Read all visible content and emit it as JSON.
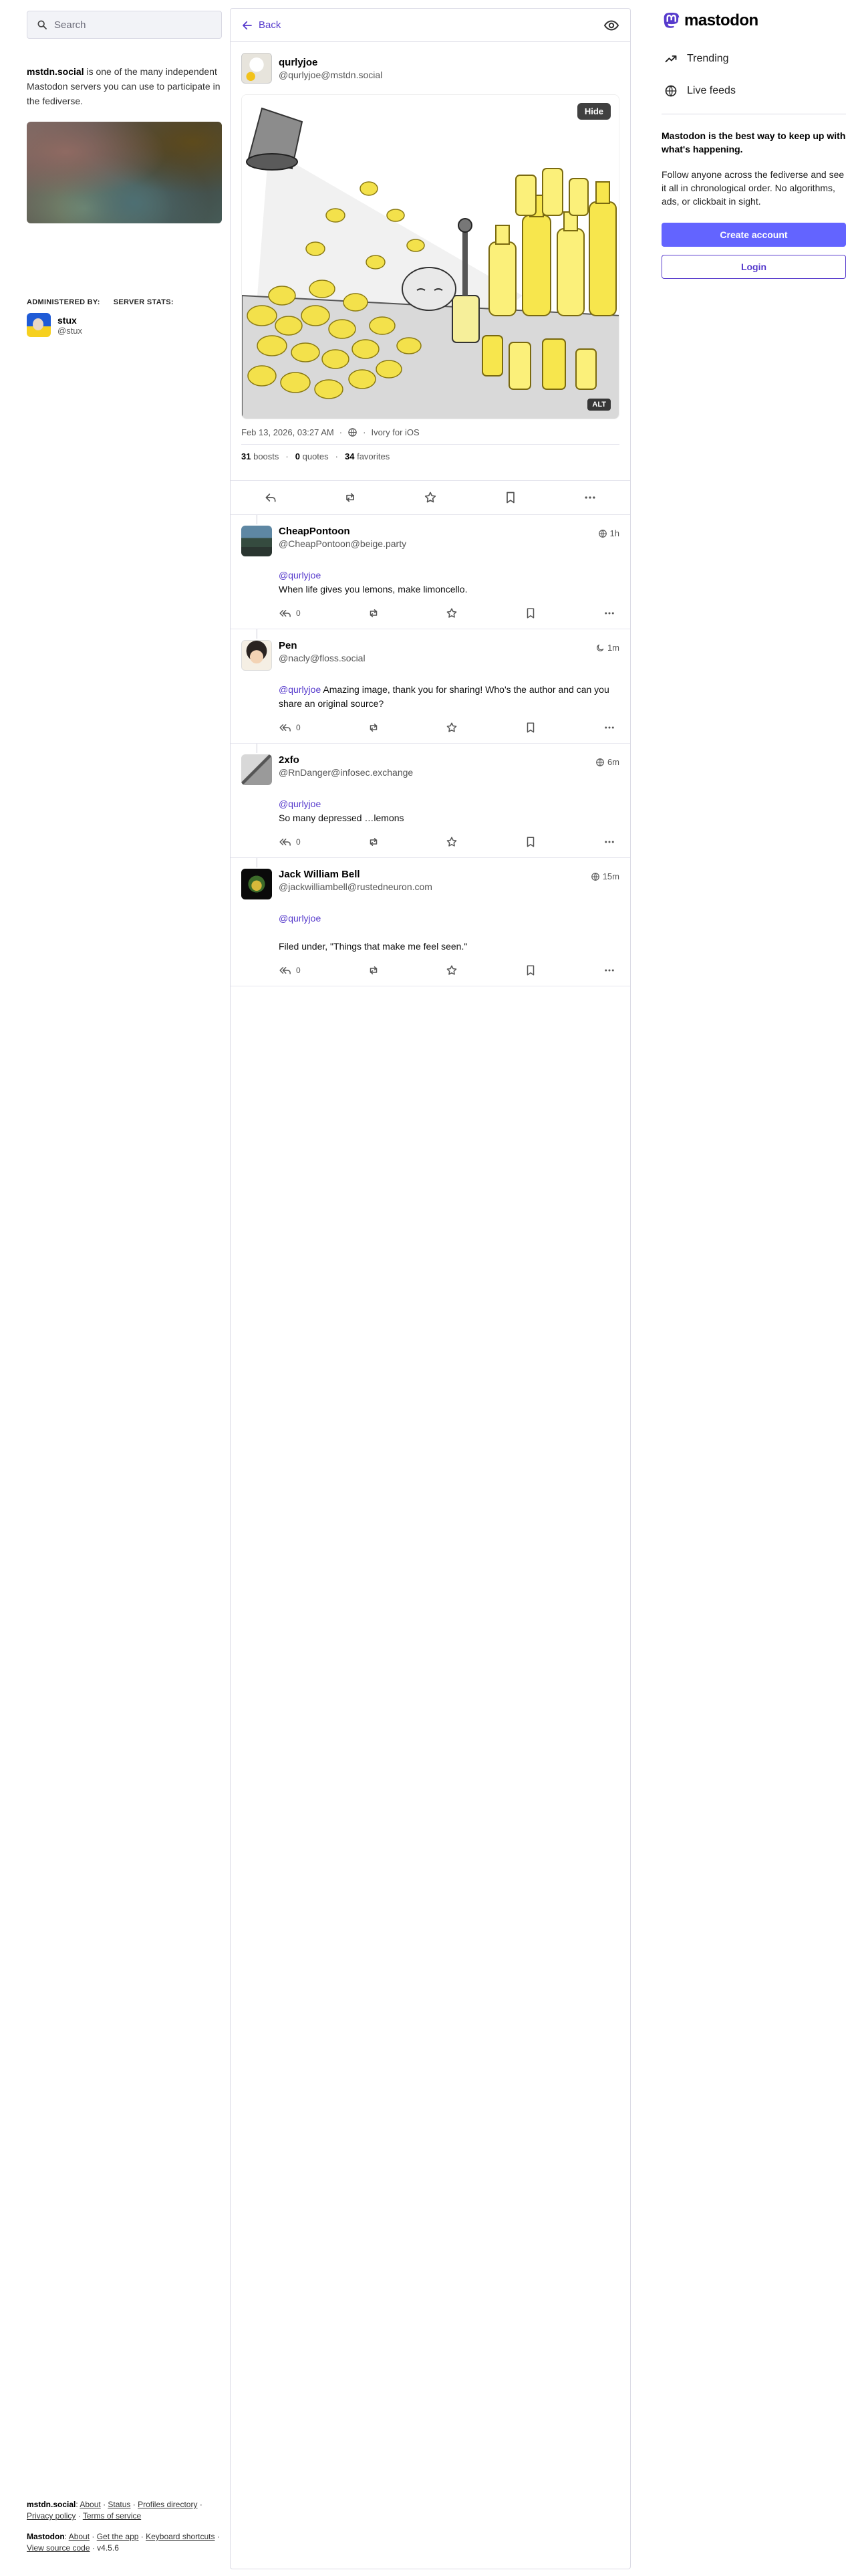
{
  "search": {
    "placeholder": "Search"
  },
  "server": {
    "name": "mstdn.social",
    "about_rest": " is one of the many independent Mastodon servers you can use to participate in the fediverse.",
    "administered_by_label": "ADMINISTERED BY:",
    "server_stats_label": "SERVER STATS:",
    "admin": {
      "name": "stux",
      "handle": "@stux"
    }
  },
  "footer": {
    "server_label": "mstdn.social",
    "server_links": [
      "About",
      "Status",
      "Profiles directory",
      "Privacy policy",
      "Terms of service"
    ],
    "mastodon_label": "Mastodon",
    "mastodon_links": [
      "About",
      "Get the app",
      "Keyboard shortcuts",
      "View source code"
    ],
    "version": "v4.5.6"
  },
  "topbar": {
    "back_label": "Back"
  },
  "post": {
    "display_name": "qurlyjoe",
    "acct": "@qurlyjoe@mstdn.social",
    "hide_label": "Hide",
    "alt_label": "ALT",
    "timestamp": "Feb 13, 2026, 03:27 AM",
    "client": "Ivory for iOS",
    "boosts": "31",
    "boosts_label": "boosts",
    "quotes": "0",
    "quotes_label": "quotes",
    "favorites": "34",
    "favorites_label": "favorites"
  },
  "replies": [
    {
      "display_name": "CheapPontoon",
      "acct": "@CheapPontoon@beige.party",
      "time": "1h",
      "visibility_icon": "globe-icon",
      "mention": "",
      "mention_line": "@qurlyjoe",
      "text": "When life gives you lemons, make limoncello.",
      "reply_count": "0"
    },
    {
      "display_name": "Pen",
      "acct": "@nacly@floss.social",
      "time": "1m",
      "visibility_icon": "moon-icon",
      "mention": "@qurlyjoe",
      "text": " Amazing image, thank you for sharing! Who's the author and can you share an original source?",
      "reply_count": "0"
    },
    {
      "display_name": "2xfo",
      "acct": "@RnDanger@infosec.exchange",
      "time": "6m",
      "visibility_icon": "globe-icon",
      "mention_line": "@qurlyjoe",
      "text": "So many depressed …lemons",
      "reply_count": "0"
    },
    {
      "display_name": "Jack William Bell",
      "acct": "@jackwilliambell@rustedneuron.com",
      "time": "15m",
      "visibility_icon": "globe-icon",
      "mention_line": "@qurlyjoe",
      "text": "Filed under, \"Things that make me feel seen.\"",
      "reply_count": "0"
    }
  ],
  "brand": {
    "name": "mastodon",
    "accent": "#6364ff",
    "link": "#563acc"
  },
  "nav": {
    "trending": "Trending",
    "live_feeds": "Live feeds"
  },
  "pitch": {
    "headline": "Mastodon is the best way to keep up with what's happening.",
    "body": "Follow anyone across the fediverse and see it all in chronological order. No algorithms, ads, or clickbait in sight."
  },
  "buttons": {
    "create_account": "Create account",
    "login": "Login"
  }
}
